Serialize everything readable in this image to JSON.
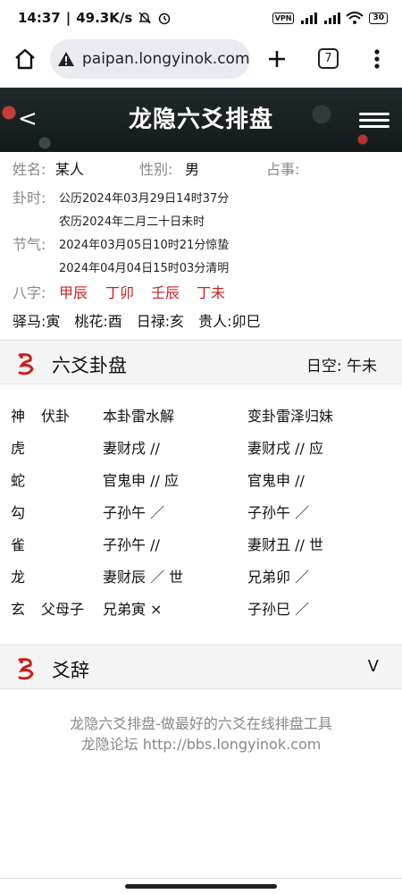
{
  "status": {
    "time": "14:37",
    "speed": "49.3K/s",
    "vpn": "VPN",
    "battery": "30"
  },
  "browser": {
    "url": "paipan.longyinok.com",
    "tab_count": "7"
  },
  "banner": {
    "back": "<",
    "title": "龙隐六爻排盘"
  },
  "info": {
    "name_label": "姓名:",
    "name_value": "某人",
    "gender_label": "性别:",
    "gender_value": "男",
    "matter_label": "占事:",
    "time_label": "卦时:",
    "time_solar": "公历2024年03月29日14时37分",
    "time_lunar": "农历2024年二月二十日未时",
    "jieqi_label": "节气:",
    "jieqi_1": "2024年03月05日10时21分惊蛰",
    "jieqi_2": "2024年04月04日15时03分清明",
    "bazi_label": "八字:",
    "bazi": [
      "甲辰",
      "丁卯",
      "壬辰",
      "丁未"
    ],
    "extras": "驿马:寅　桃花:酉　日禄:亥　贵人:卯巳"
  },
  "gua_section": {
    "title": "六爻卦盘",
    "rikong": "日空:  午未"
  },
  "gua_table": {
    "headers": [
      "神",
      "伏卦",
      "本卦雷水解",
      "变卦雷泽归妹"
    ],
    "rows": [
      [
        "虎",
        "",
        "妻财戌 //",
        "妻财戌 // 应"
      ],
      [
        "蛇",
        "",
        "官鬼申 // 应",
        "官鬼申 //"
      ],
      [
        "勾",
        "",
        "子孙午 ／",
        "子孙午 ／"
      ],
      [
        "雀",
        "",
        "子孙午 //",
        "妻财丑 // 世"
      ],
      [
        "龙",
        "",
        "妻财辰 ／ 世",
        "兄弟卯 ／"
      ],
      [
        "玄",
        "父母子",
        "兄弟寅 ×",
        "子孙巳 ／"
      ]
    ]
  },
  "yaoci_section": {
    "title": "爻辞",
    "toggle": "V"
  },
  "footer": {
    "line1": "龙隐六爻排盘-做最好的六爻在线排盘工具",
    "line2": "龙隐论坛 http://bbs.longyinok.com"
  }
}
